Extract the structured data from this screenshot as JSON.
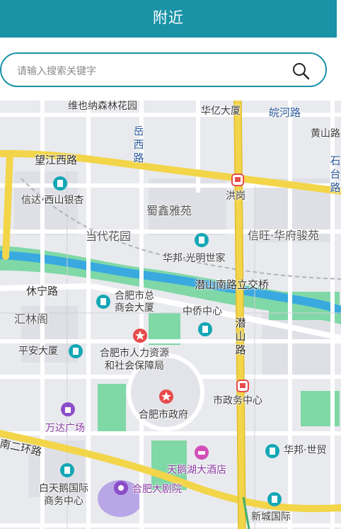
{
  "header": {
    "title": "附近"
  },
  "search": {
    "placeholder": "请输入搜索关键字"
  },
  "colors": {
    "accent": "#1a93a7",
    "road_major": "#f3d54a",
    "water": "#39a9e0",
    "park": "#7fd8a6"
  },
  "map": {
    "labels": {
      "weiyena": "维也纳森林花园",
      "huayi": "华亿大厦",
      "wanhe_road": "皖河路",
      "huangshan_road": "黄山路",
      "yuexi_road": "岳西路",
      "shi_road_edge": "石台路",
      "wangjiang_road": "望江西路",
      "honggang": "洪岗",
      "xinda": "信达·西山银杏",
      "shuxin": "蜀鑫雅苑",
      "dangdai": "当代花园",
      "xinwang": "信旺·华府骏苑",
      "huabang_guangming": "华邦·光明世家",
      "xiuning_road": "休宁路",
      "qianshan_bridge": "潜山南路立交桥",
      "shangshui": "合肥市总\n商会大厦",
      "huilin": "汇林阁",
      "zhongqiao": "中侨中心",
      "qianshan_road": "潜山路",
      "pingan": "平安大厦",
      "hrss": "合肥市人力资源\n和社会保障局",
      "shizhengwu": "市政务中心",
      "government": "合肥市政府",
      "wanda": "万达广场",
      "ring2": "南二环路",
      "huabang_shimao": "华邦·世贸",
      "tiane_hotel": "天鹅湖大酒店",
      "baitiane": "白天鹅国际\n商务中心",
      "grand_theatre": "合肥大剧院",
      "xincheng": "新城国际"
    }
  }
}
